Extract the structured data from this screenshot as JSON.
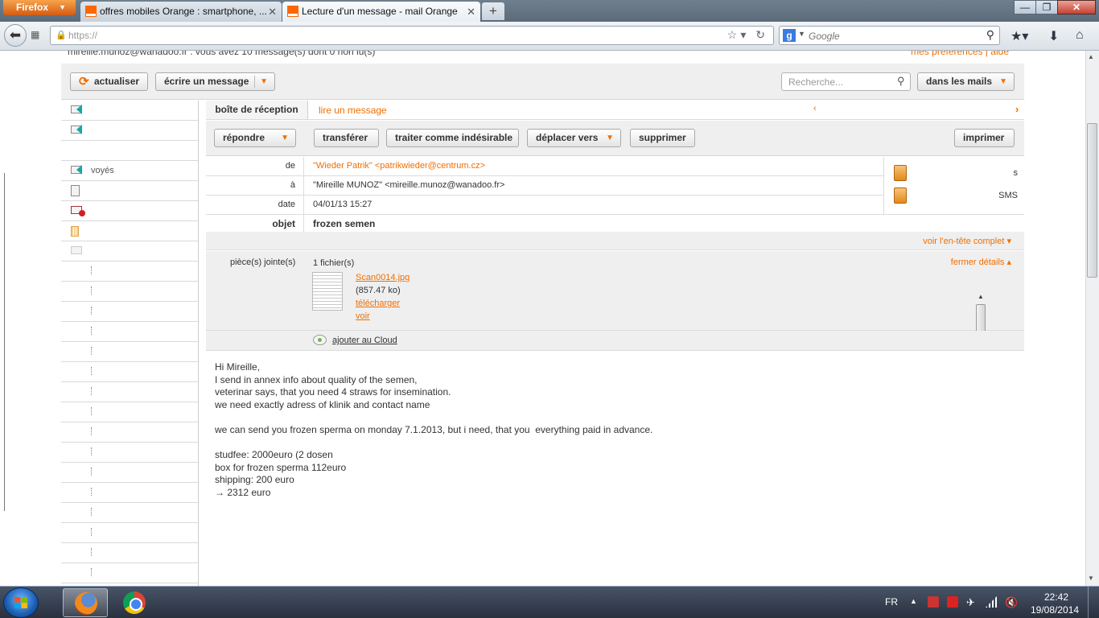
{
  "browser": {
    "menu_label": "Firefox",
    "tabs": [
      {
        "label": "offres mobiles Orange : smartphone, ..."
      },
      {
        "label": "Lecture d'un message - mail Orange"
      }
    ],
    "new_tab_label": "+",
    "url": "https://",
    "search_placeholder": "Google",
    "window_buttons": {
      "minimize": "—",
      "maximize": "❐",
      "close": "✕"
    }
  },
  "page": {
    "account_line": "mireille.munoz@wanadoo.fr : vous avez 10 message(s) dont 0 non lu(s)",
    "prefs_link": "mes préférences | aide",
    "toolbar": {
      "refresh_label": "actualiser",
      "compose_label": "écrire un message",
      "search_placeholder": "Recherche...",
      "scope_label": "dans les mails"
    },
    "breadcrumb": {
      "inbox": "boîte de réception",
      "current": "lire un message"
    },
    "actions": {
      "reply": "répondre",
      "forward": "transférer",
      "spam": "traiter comme indésirable",
      "move": "déplacer vers",
      "delete": "supprimer",
      "print": "imprimer"
    },
    "headers": {
      "from_key": "de",
      "from_value": "\"Wieder Patrik\" <patrikwieder@centrum.cz>",
      "to_key": "à",
      "to_value": "\"Mireille MUNOZ\" <mireille.munoz@wanadoo.fr>",
      "date_key": "date",
      "date_value": "04/01/13 15:27",
      "subject_key": "objet",
      "subject_value": "frozen semen"
    },
    "side_actions": {
      "contacts": "s",
      "sms": "SMS"
    },
    "full_header_link": "voir l'en-tête complet",
    "attachments": {
      "label": "pièce(s) jointe(s)",
      "count": "1 fichier(s)",
      "close_details": "fermer détails",
      "file_name": "Scan0014.jpg",
      "file_size": "(857.47 ko)",
      "download": "télécharger",
      "view": "voir",
      "cloud": "ajouter au Cloud"
    },
    "body_lines": [
      "Hi Mireille,",
      "I send in annex info about quality of the semen,",
      "veterinar says, that you need 4 straws for insemination.",
      "we need exactly adress of klinik and contact name",
      "",
      "we can send you frozen sperma on monday 7.1.2013, but i need, that you  everything paid in advance.",
      "",
      "studfee: 2000euro (2 dosen",
      "box for frozen sperma 112euro",
      "shipping: 200 euro",
      "→ 2312 euro"
    ],
    "sidebar_labels": {
      "sent": "voyés"
    }
  },
  "taskbar": {
    "lang": "FR",
    "time": "22:42",
    "date": "19/08/2014"
  },
  "colors": {
    "accent": "#f16e00",
    "toolbar_bg": "#efefef"
  }
}
